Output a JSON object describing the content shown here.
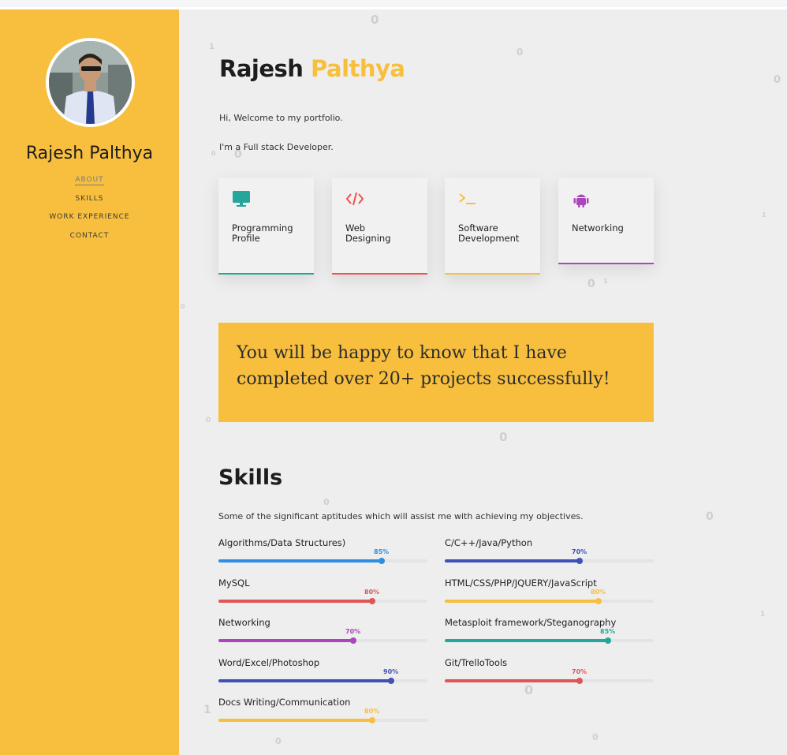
{
  "sidebar": {
    "name": "Rajesh Palthya",
    "nav": [
      {
        "label": "ABOUT"
      },
      {
        "label": "SKILLS"
      },
      {
        "label": "WORK EXPERIENCE"
      },
      {
        "label": "CONTACT"
      }
    ]
  },
  "header": {
    "first_name": "Rajesh",
    "last_name": "Palthya"
  },
  "intro": {
    "line1": "Hi, Welcome to my portfolio.",
    "line2": "I'm a Full stack Developer."
  },
  "cards": [
    {
      "line1": "Programming",
      "line2": "Profile",
      "icon": "monitor-icon",
      "color": "#26a69a"
    },
    {
      "line1": "Web",
      "line2": "Designing",
      "icon": "code-icon",
      "color": "#ef5350"
    },
    {
      "line1": "Software",
      "line2": "Development",
      "icon": "terminal-icon",
      "color": "#f8bf3e"
    },
    {
      "line1": "Networking",
      "line2": "",
      "icon": "android-icon",
      "color": "#ab47bc"
    }
  ],
  "banner": {
    "text": "You will be happy to know that I have completed over 20+ projects successfully!"
  },
  "skills": {
    "title": "Skills",
    "subtitle": "Some of the significant aptitudes which will assist me with achieving my objectives.",
    "items": [
      {
        "name": "Algorithms/Data Structures)",
        "percent": 85,
        "label": "85%",
        "color": "#2e8fe0"
      },
      {
        "name": "C/C++/Java/Python",
        "percent": 70,
        "label": "70%",
        "color": "#3f51b5"
      },
      {
        "name": "MySQL",
        "percent": 80,
        "label": "80%",
        "color": "#e05555"
      },
      {
        "name": "HTML/CSS/PHP/JQUERY/JavaScript",
        "percent": 80,
        "label": "80%",
        "color": "#f8bf3e"
      },
      {
        "name": "Networking",
        "percent": 70,
        "label": "70%",
        "color": "#ab47bc"
      },
      {
        "name": "Metasploit framework/Steganography",
        "percent": 85,
        "label": "85%",
        "color": "#26a69a"
      },
      {
        "name": "Word/Excel/Photoshop",
        "percent": 90,
        "label": "90%",
        "color": "#3f51b5"
      },
      {
        "name": "Git/TrelloTools",
        "percent": 70,
        "label": "70%",
        "color": "#e05555"
      },
      {
        "name": "Docs Writing/Communication",
        "percent": 80,
        "label": "80%",
        "color": "#f8bf3e"
      }
    ]
  },
  "background_digits": [
    "0",
    "0",
    "1",
    "0",
    "0",
    "0",
    "1",
    "0",
    "0",
    "0",
    "0",
    "1",
    "0",
    "0",
    "0",
    "1",
    "0",
    "0",
    "1"
  ],
  "colors": {
    "accent": "#f8bf3e",
    "main_bg": "#eeeeee"
  }
}
